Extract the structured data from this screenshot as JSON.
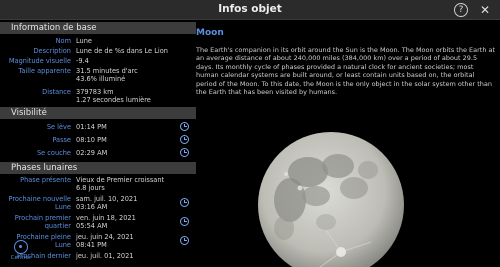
{
  "window": {
    "title": "Infos objet"
  },
  "sections": {
    "base": "Information de base",
    "visibility": "Visibilité",
    "phases": "Phases lunaires"
  },
  "base": [
    {
      "label": "Nom",
      "value": "Lune"
    },
    {
      "label": "Description",
      "value": "Lune de de %s  dans Le Lion"
    },
    {
      "label": "Magnitude visuelle",
      "value": "-9.4"
    },
    {
      "label": "Taille apparente",
      "value": "31.5 minutes d'arc",
      "value2": "43.6% illuminé"
    },
    {
      "label": "Distance",
      "value": "379783 km",
      "value2": "1.27 secondes lumière"
    }
  ],
  "visibility": [
    {
      "label": "Se lève",
      "value": "01:14 PM"
    },
    {
      "label": "Passe",
      "value": "08:10 PM"
    },
    {
      "label": "Se couche",
      "value": "02:29 AM"
    }
  ],
  "phases": [
    {
      "label": "Phase présente",
      "value": "Vieux de Premier croissant",
      "value2": "6.8 jours"
    },
    {
      "label": "Prochaine nouvelle",
      "label2": "Lune",
      "value": "sam. juil. 10, 2021",
      "value2": "03:16 AM"
    },
    {
      "label": "Prochain premier",
      "label2": "quartier",
      "value": "ven. juin 18, 2021",
      "value2": "05:54 AM"
    },
    {
      "label": "Prochaine pleine",
      "label2": "Lune",
      "value": "jeu. juin 24, 2021",
      "value2": "08:41 PM"
    },
    {
      "label": "Prochain dernier",
      "value": "jeu. juil. 01, 2021"
    }
  ],
  "object": {
    "name": "Moon",
    "description": "The Earth's companion in its orbit around the Sun is the Moon. The Moon orbits the Earth at an average distance of about 240,000 miles (384,000 km) over a period of about 29.5 days. Its monthly cycle of phases provided a natural clock for ancient societies; most human calendar systems are built around, or least contain units based on, the orbital period of the Moon. To this date, the Moon is the only object in the solar system other than the Earth that has been visited by humans."
  },
  "toolbar": {
    "centrer": "Centrer"
  },
  "colors": {
    "accent": "#5b8fe0",
    "header_bg": "#3c3c3c",
    "titlebar_bg": "#2b2b2b"
  }
}
